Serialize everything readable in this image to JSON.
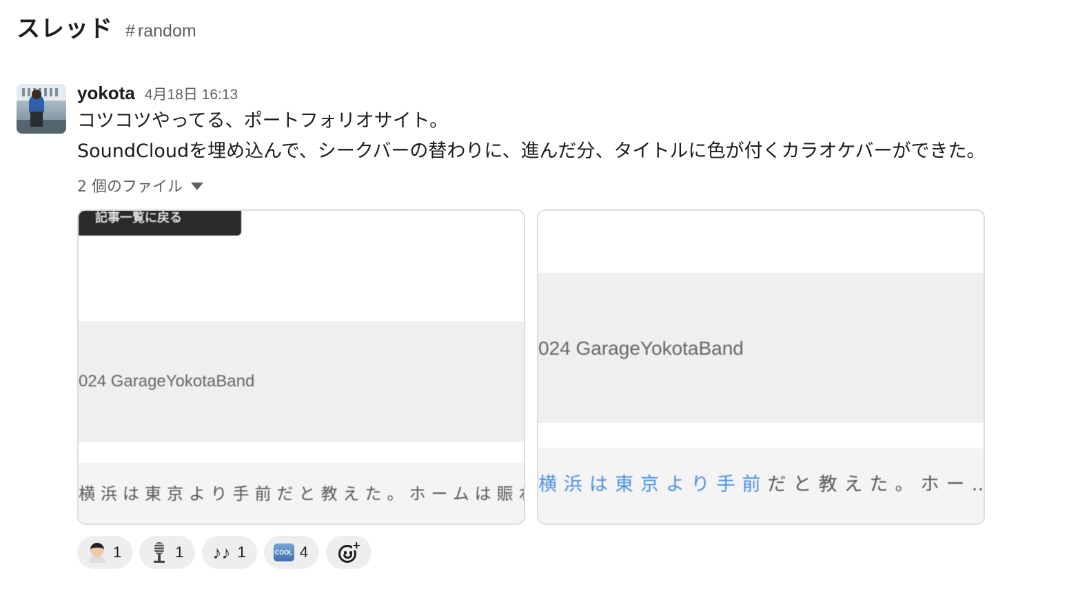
{
  "header": {
    "title": "スレッド",
    "channel_hash": "#",
    "channel_name": "random"
  },
  "message": {
    "username": "yokota",
    "timestamp": "4月18日 16:13",
    "lines": [
      "コツコツやってる、ポートフォリオサイト。",
      "SoundCloudを埋め込んで、シークバーの替わりに、進んだ分、タイトルに色が付くカラオケバーができた。"
    ],
    "files_label": "2 個のファイル"
  },
  "files": [
    {
      "back_button": "記事一覧に戻る",
      "band_text": "024 GarageYokotaBand",
      "lyric_highlight": "",
      "lyric_rest": "横浜は東京より手前だと教えた。ホームは賑わ"
    },
    {
      "band_text": "024 GarageYokotaBand",
      "lyric_highlight": "横浜は東京より手前",
      "lyric_rest": "だと教えた。ホー…"
    }
  ],
  "reactions": [
    {
      "emoji": "face-emoji",
      "count": "1"
    },
    {
      "emoji": "microphone-emoji",
      "count": "1"
    },
    {
      "emoji": "notes-emoji",
      "glyph": "♪♪",
      "count": "1"
    },
    {
      "emoji": "cool-emoji",
      "glyph": "COOL",
      "count": "4"
    }
  ],
  "colors": {
    "lyric_highlight": "#4a8fe0",
    "reaction_bg": "#eeeeee",
    "muted_text": "#616061"
  }
}
